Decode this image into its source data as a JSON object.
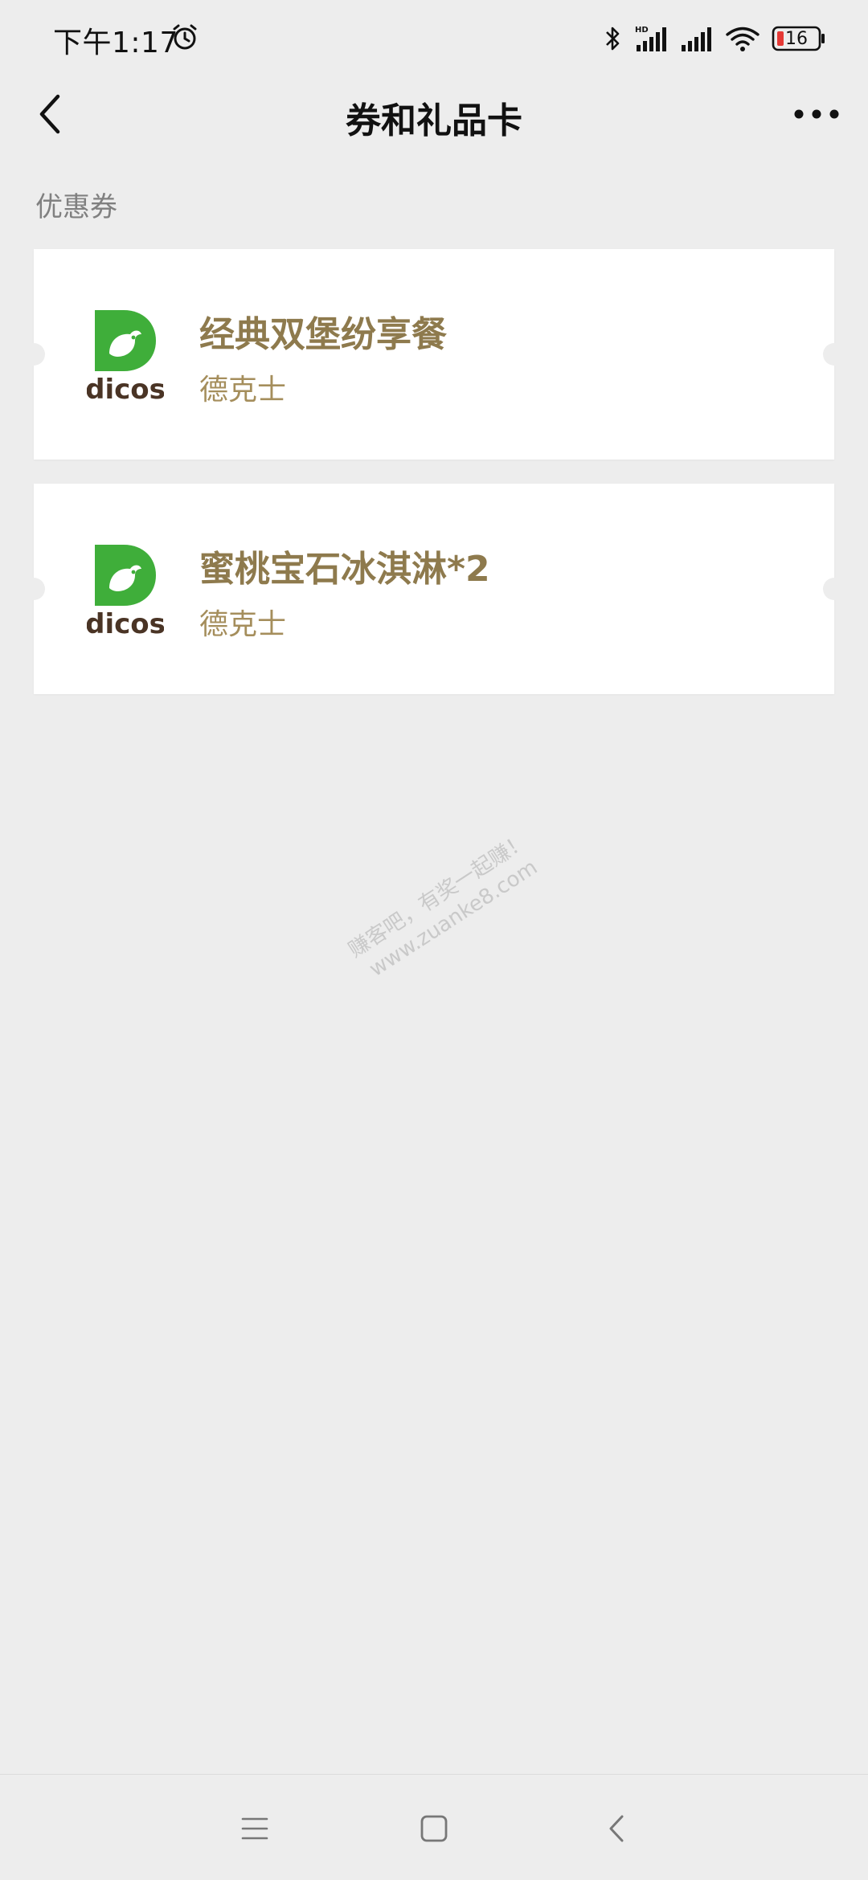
{
  "status_bar": {
    "time": "下午1:17",
    "battery_level": "16",
    "icons": [
      "alarm-icon",
      "bluetooth-icon",
      "hd-signal-icon",
      "signal-icon",
      "wifi-icon",
      "battery-icon"
    ]
  },
  "header": {
    "title": "券和礼品卡",
    "back_icon": "chevron-left-icon",
    "more_icon": "more-dots-icon"
  },
  "section": {
    "label": "优惠券"
  },
  "coupons": [
    {
      "logo_icon": "dicos-logo",
      "logo_text": "dicos",
      "title": "经典双堡纷享餐",
      "brand": "德克士"
    },
    {
      "logo_icon": "dicos-logo",
      "logo_text": "dicos",
      "title": "蜜桃宝石冰淇淋*2",
      "brand": "德克士"
    }
  ],
  "watermark": {
    "line1": "赚客吧，有奖一起赚！",
    "line2": "www.zuanke8.com"
  },
  "colors": {
    "background": "#ededed",
    "card": "#ffffff",
    "coupon_title": "#8e7a4d",
    "coupon_brand": "#a58e5c",
    "dicos_green": "#3fae3a",
    "dicos_brown": "#4a3425"
  },
  "bottom_nav": {
    "icons": [
      "menu-icon",
      "home-square-icon",
      "back-chevron-icon"
    ]
  }
}
